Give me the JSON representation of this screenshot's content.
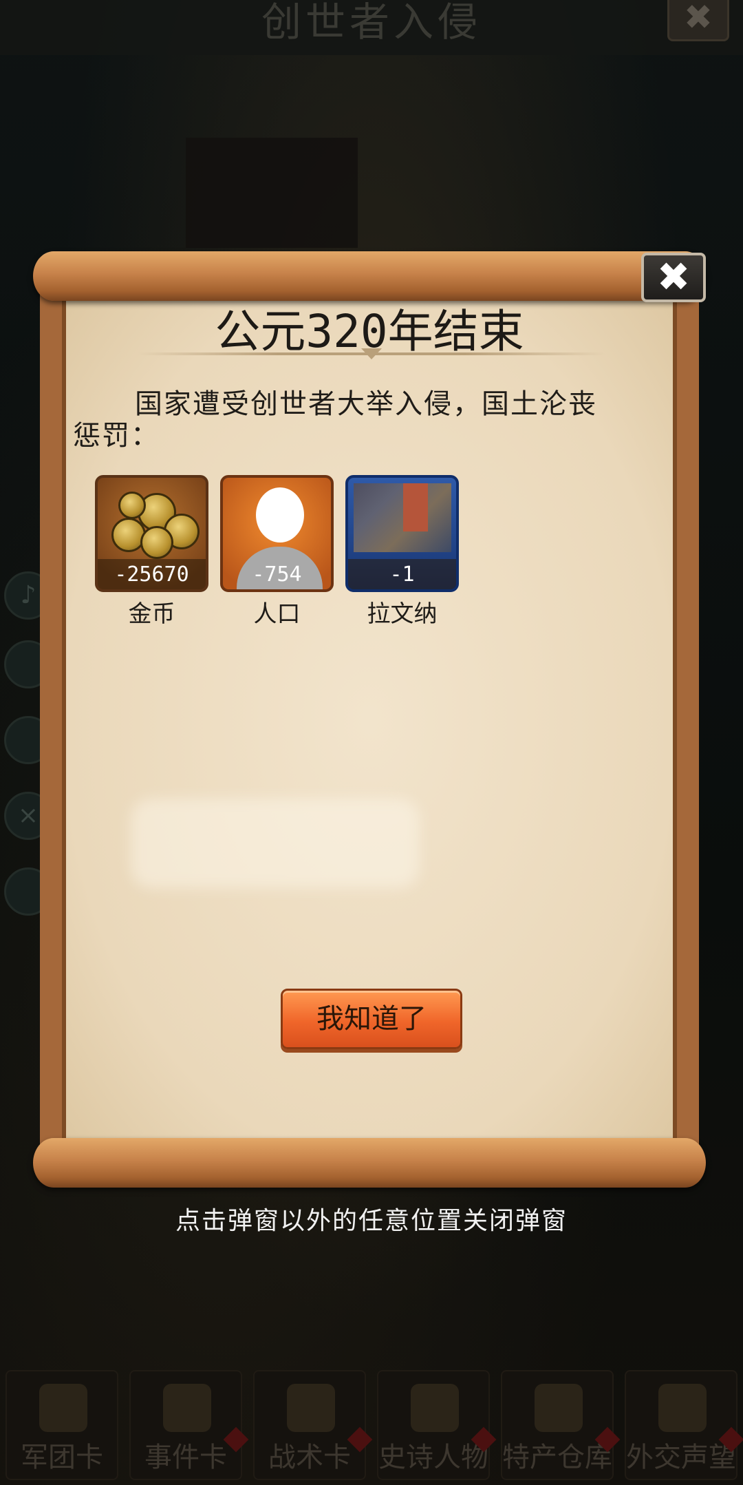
{
  "background": {
    "title": "创世者入侵",
    "close_glyph": "✖",
    "bottom_nav": [
      {
        "label": "军团卡"
      },
      {
        "label": "事件卡"
      },
      {
        "label": "战术卡"
      },
      {
        "label": "史诗人物"
      },
      {
        "label": "特产仓库"
      },
      {
        "label": "外交声望"
      }
    ]
  },
  "dialog": {
    "close_glyph": "✖",
    "title": "公元320年结束",
    "message": "国家遭受创世者大举入侵，国土沦丧惩罚：",
    "penalties": [
      {
        "value": "-25670",
        "label": "金币",
        "icon": "gold-coins-icon"
      },
      {
        "value": "-754",
        "label": "人口",
        "icon": "population-icon"
      },
      {
        "value": "-1",
        "label": "拉文纳",
        "icon": "city-ravenna-icon"
      }
    ],
    "confirm_label": "我知道了"
  },
  "hint": "点击弹窗以外的任意位置关闭弹窗",
  "colors": {
    "scroll_rod": "#c7824a",
    "paper": "#ead8ba",
    "confirm_button": "#f0662a",
    "city_tile": "#2f5aa8"
  }
}
